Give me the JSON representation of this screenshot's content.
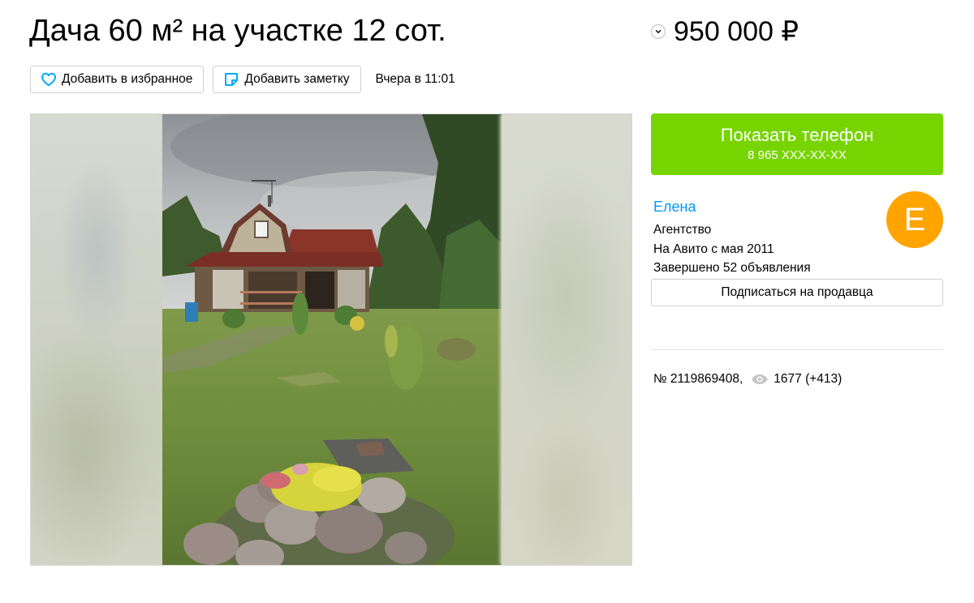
{
  "listing": {
    "title": "Дача 60 м² на участке 12 сот.",
    "price": "950 000 ₽",
    "price_toggle_icon": "chevron-down-icon",
    "published": "Вчера в 11:01",
    "number": "№ 2119869408,",
    "views": "1677 (+413)"
  },
  "actions": {
    "favorite_label": "Добавить в избранное",
    "favorite_icon": "heart-icon",
    "note_label": "Добавить заметку",
    "note_icon": "note-icon"
  },
  "contact": {
    "show_phone_label": "Показать телефон",
    "phone_masked": "8 965 XXX-XX-XX"
  },
  "seller": {
    "name": "Елена",
    "type": "Агентство",
    "since": "На Авито с мая 2011",
    "completed": "Завершено 52 объявления",
    "avatar_letter": "Е",
    "subscribe_label": "Подписаться на продавца"
  },
  "colors": {
    "accent_green": "#77d400",
    "link_blue": "#0099f7",
    "avatar_orange": "#ffa400",
    "icon_blue": "#00aaff"
  }
}
